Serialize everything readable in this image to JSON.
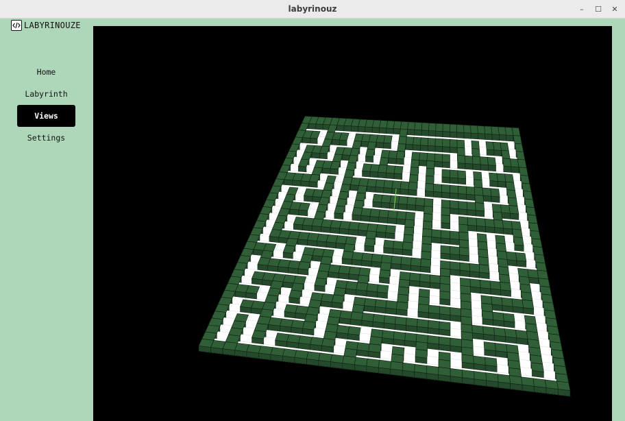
{
  "window": {
    "title": "labyrinouz",
    "minimize": "–",
    "maximize": "☐",
    "close": "✕"
  },
  "sidebar": {
    "logo_text": "LABYRINOUZE",
    "items": [
      {
        "label": "Home",
        "active": false
      },
      {
        "label": "Labyrinth",
        "active": false
      },
      {
        "label": "Views",
        "active": true
      },
      {
        "label": "Settings",
        "active": false
      }
    ]
  },
  "scene": {
    "background": "#000000",
    "wall_color": "#2f5e37",
    "floor_color": "#ffffff",
    "grid_line_color": "#0c1f10",
    "marker_color": "#7fd64a"
  }
}
